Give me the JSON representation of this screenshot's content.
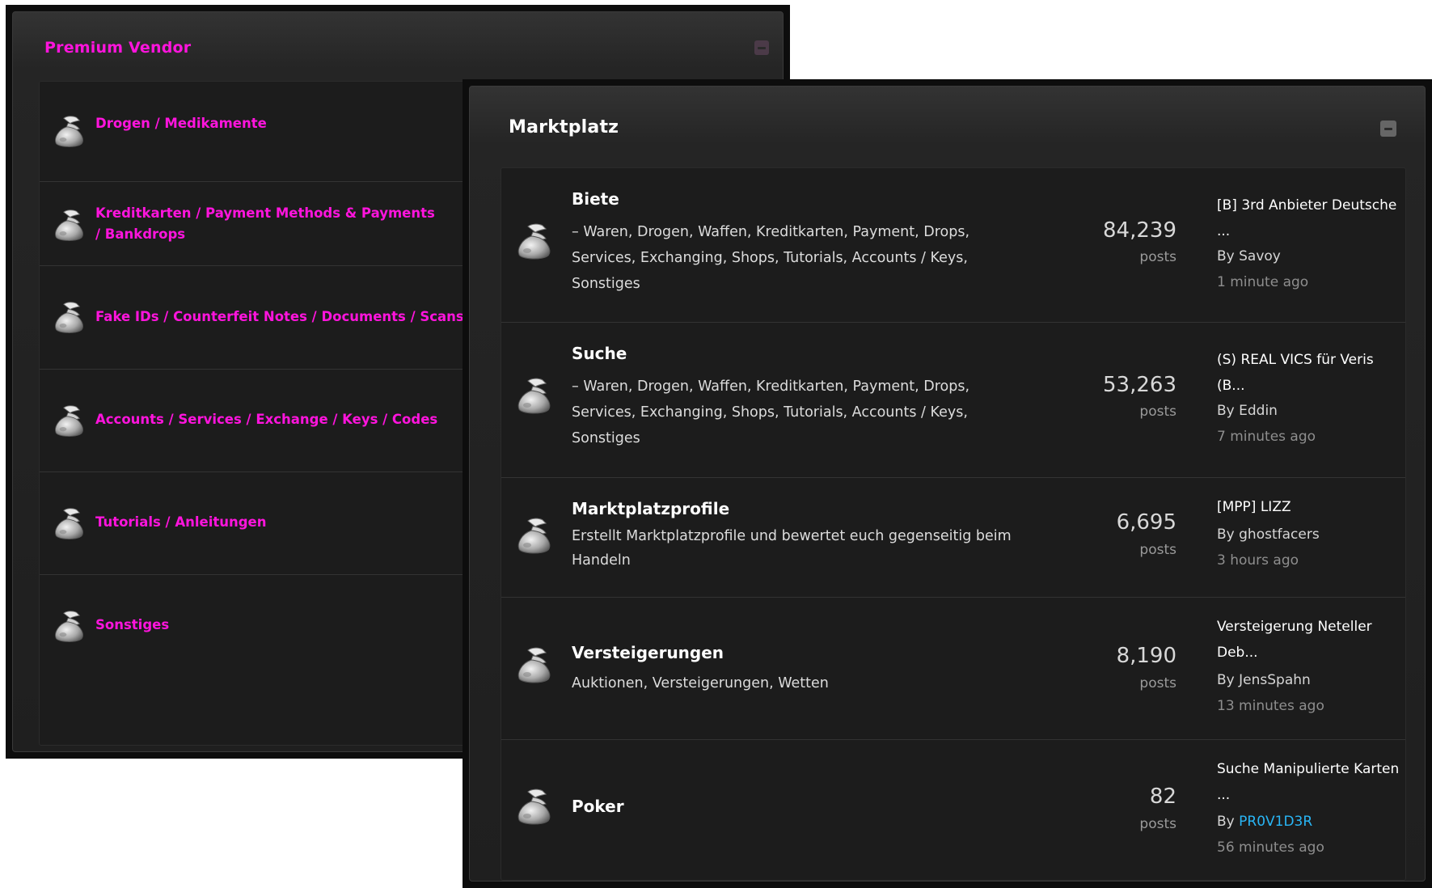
{
  "premium_vendor": {
    "title": "Premium Vendor",
    "categories": [
      {
        "label": "Drogen / Medikamente"
      },
      {
        "label": "Kreditkarten / Payment Methods & Payments / Bankdrops"
      },
      {
        "label": "Fake IDs / Counterfeit Notes / Documents / Scans"
      },
      {
        "label": "Accounts / Services / Exchange / Keys / Codes"
      },
      {
        "label": "Tutorials / Anleitungen"
      },
      {
        "label": "Sonstiges"
      }
    ]
  },
  "marktplatz": {
    "title": "Marktplatz",
    "forums": [
      {
        "title": "Biete",
        "description": "– Waren, Drogen, Waffen, Kreditkarten, Payment, Drops, Services, Exchanging, Shops, Tutorials, Accounts / Keys, Sonstiges",
        "count": "84,239",
        "count_label": "posts",
        "last_post_title": "[B] 3rd Anbieter Deutsche ...",
        "last_post_by": "By Savoy",
        "last_post_time": "1 minute ago"
      },
      {
        "title": "Suche",
        "description": "– Waren, Drogen, Waffen, Kreditkarten, Payment, Drops, Services, Exchanging, Shops, Tutorials, Accounts / Keys, Sonstiges",
        "count": "53,263",
        "count_label": "posts",
        "last_post_title": "(S) REAL VICS für Veris (B...",
        "last_post_by": "By Eddin",
        "last_post_time": "7 minutes ago"
      },
      {
        "title": "Marktplatzprofile",
        "description": "Erstellt Marktplatzprofile und bewertet euch gegenseitig beim Handeln",
        "count": "6,695",
        "count_label": "posts",
        "last_post_title": "[MPP] LIZZ",
        "last_post_by": "By ghostfacers",
        "last_post_time": "3 hours ago"
      },
      {
        "title": "Versteigerungen",
        "description": "Auktionen, Versteigerungen, Wetten",
        "count": "8,190",
        "count_label": "posts",
        "last_post_title": "Versteigerung Neteller Deb...",
        "last_post_by": "By JensSpahn",
        "last_post_time": "13 minutes ago"
      },
      {
        "title": "Poker",
        "description": "",
        "count": "82",
        "count_label": "posts",
        "last_post_title": "Suche Manipulierte Karten ...",
        "last_post_by_prefix": "By ",
        "last_post_by_user": "PR0V1D3R",
        "last_post_time": "56 minutes ago"
      }
    ]
  },
  "colors": {
    "accent_pink": "#ff14dd",
    "user_link_blue": "#29b6f6"
  },
  "icons": {
    "forum_icon": "money-bag-icon",
    "collapse": "collapse-icon"
  }
}
